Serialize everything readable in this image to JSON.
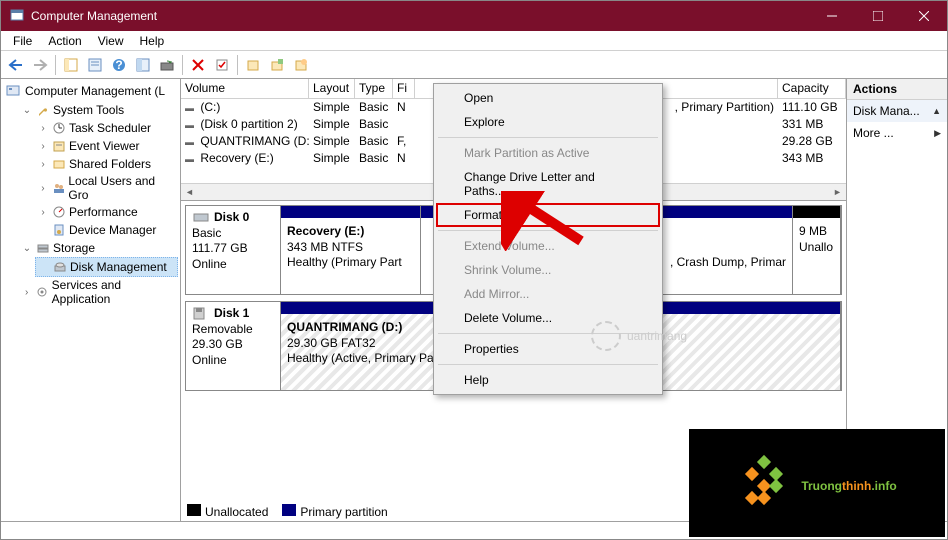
{
  "window": {
    "title": "Computer Management"
  },
  "menubar": [
    "File",
    "Action",
    "View",
    "Help"
  ],
  "tree": {
    "root": "Computer Management (L",
    "system_tools": {
      "label": "System Tools",
      "children": [
        "Task Scheduler",
        "Event Viewer",
        "Shared Folders",
        "Local Users and Gro",
        "Performance",
        "Device Manager"
      ]
    },
    "storage": {
      "label": "Storage",
      "children": [
        "Disk Management"
      ]
    },
    "services": "Services and Application"
  },
  "columns": {
    "volume": "Volume",
    "layout": "Layout",
    "type": "Type",
    "fs": "Fi",
    "status": "",
    "capacity": "Capacity"
  },
  "volumes": [
    {
      "name": "(C:)",
      "layout": "Simple",
      "type": "Basic",
      "fs": "N",
      "status": ", Primary Partition)",
      "capacity": "111.10 GB"
    },
    {
      "name": "(Disk 0 partition 2)",
      "layout": "Simple",
      "type": "Basic",
      "fs": "",
      "status": "",
      "capacity": "331 MB"
    },
    {
      "name": "QUANTRIMANG (D:)",
      "layout": "Simple",
      "type": "Basic",
      "fs": "F,",
      "status": "",
      "capacity": "29.28 GB"
    },
    {
      "name": "Recovery (E:)",
      "layout": "Simple",
      "type": "Basic",
      "fs": "N",
      "status": "",
      "capacity": "343 MB"
    }
  ],
  "disks": {
    "disk0": {
      "name": "Disk 0",
      "type": "Basic",
      "size": "111.77 GB",
      "status": "Online",
      "part1": {
        "name": "Recovery  (E:)",
        "size": "343 MB NTFS",
        "health": "Healthy (Primary Part"
      },
      "part2": {
        "health": ", Crash Dump, Primar"
      },
      "part3": {
        "size": "9 MB",
        "health": "Unallo"
      }
    },
    "disk1": {
      "name": "Disk 1",
      "type": "Removable",
      "size": "29.30 GB",
      "status": "Online",
      "part1": {
        "name": "QUANTRIMANG (D:)",
        "size": "29.30 GB FAT32",
        "health": "Healthy (Active, Primary Partition)"
      }
    }
  },
  "legend": {
    "unalloc": "Unallocated",
    "primary": "Primary partition"
  },
  "actions": {
    "header": "Actions",
    "item1": "Disk Mana...",
    "item2": "More ..."
  },
  "context_menu": {
    "open": "Open",
    "explore": "Explore",
    "mark_active": "Mark Partition as Active",
    "change_letter": "Change Drive Letter and Paths...",
    "format": "Format...",
    "extend": "Extend Volume...",
    "shrink": "Shrink Volume...",
    "add_mirror": "Add Mirror...",
    "delete": "Delete Volume...",
    "properties": "Properties",
    "help": "Help"
  },
  "watermark": "uantrimang",
  "logo": {
    "text1": "Truong",
    "text2": "thinh",
    "text3": ".info"
  }
}
